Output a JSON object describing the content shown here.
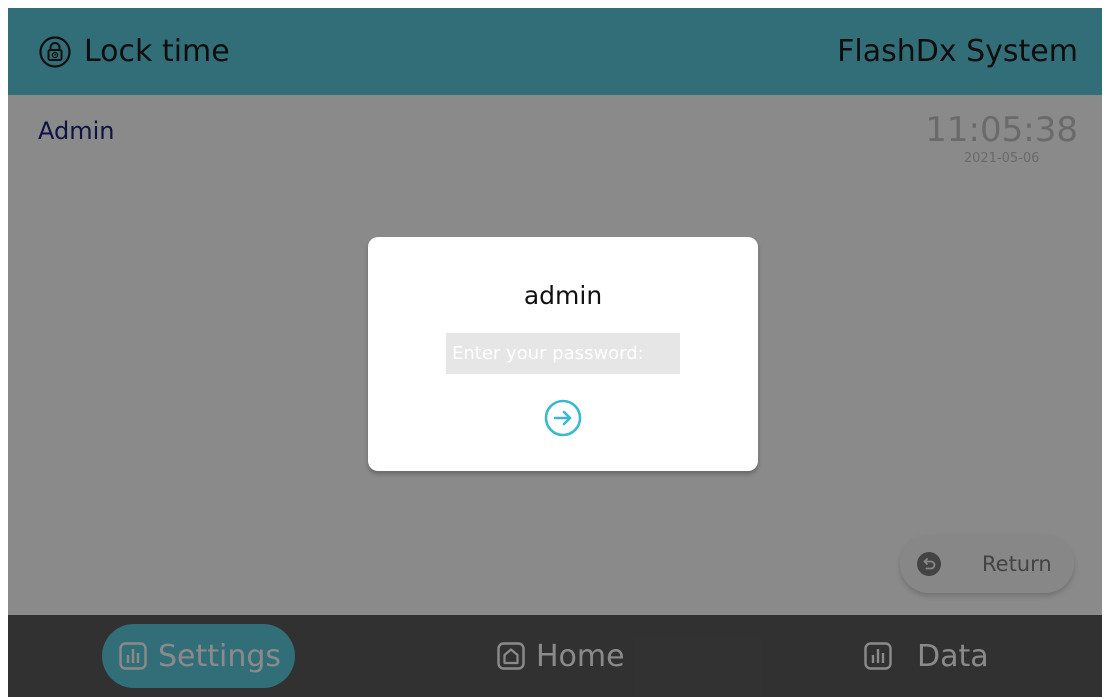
{
  "header": {
    "title": "Lock time",
    "title_icon": "lock-clock-icon",
    "system_name": "FlashDx System"
  },
  "main": {
    "user_name": "Admin",
    "clock": {
      "time": "11:05:38",
      "date": "2021-05-06"
    },
    "return_button": {
      "label": "Return",
      "icon": "return-icon"
    }
  },
  "dialog": {
    "username": "admin",
    "password": {
      "value": "",
      "placeholder": "Enter your password:"
    },
    "submit_icon": "arrow-right-circle-icon"
  },
  "bottom_nav": {
    "items": [
      {
        "label": "Settings",
        "icon": "bar-chart-icon",
        "active": true
      },
      {
        "label": "Home",
        "icon": "home-icon",
        "active": false
      },
      {
        "label": "Data",
        "icon": "bar-chart-icon",
        "active": false
      }
    ]
  },
  "colors": {
    "accent": "#5ccbdd",
    "nav_background": "#5c5c5c",
    "user_name": "#1a237e"
  }
}
